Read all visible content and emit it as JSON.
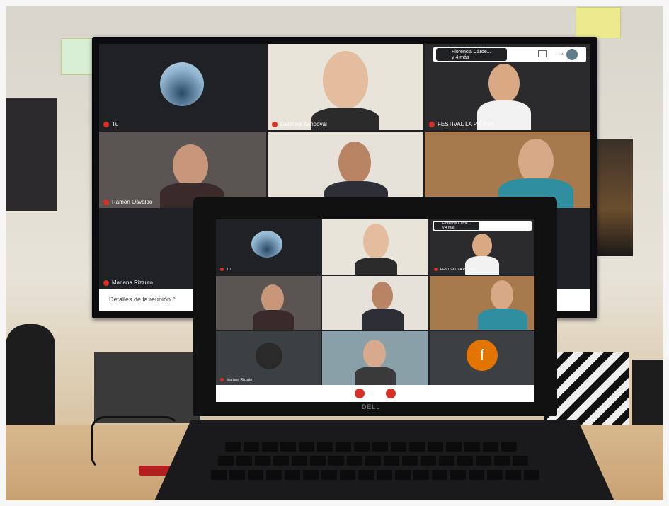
{
  "tv": {
    "top_bar_label": "Florencia Cárde...",
    "top_bar_sub": "y 4 más",
    "you_short": "Tú",
    "tiles": [
      {
        "name": "Tú"
      },
      {
        "name": "Gabriela Sandoval"
      },
      {
        "name": "FESTIVAL LA PICASA"
      },
      {
        "name": "Ramón Osvaldo"
      },
      {
        "name": ""
      },
      {
        "name": ""
      },
      {
        "name": "Mariana Rizzuto"
      }
    ],
    "details": "Detalles de la reunión",
    "chevron": "^"
  },
  "laptop": {
    "top_bar_label": "Florencia Cárde...",
    "top_bar_sub": "y 4 más",
    "tiles": [
      {
        "name": "Tú"
      },
      {
        "name": ""
      },
      {
        "name": "FESTIVAL LA PICASA"
      },
      {
        "name": ""
      },
      {
        "name": ""
      },
      {
        "name": ""
      },
      {
        "name": "Mariana Rizzuto"
      },
      {
        "name": ""
      },
      {
        "name": ""
      }
    ],
    "avatar_letter": "f",
    "brand": "DELL"
  },
  "colors": {
    "meet_bg": "#202124",
    "tile_bg": "#3c4043",
    "mic_red": "#d93025",
    "avatar_orange": "#e37400"
  }
}
